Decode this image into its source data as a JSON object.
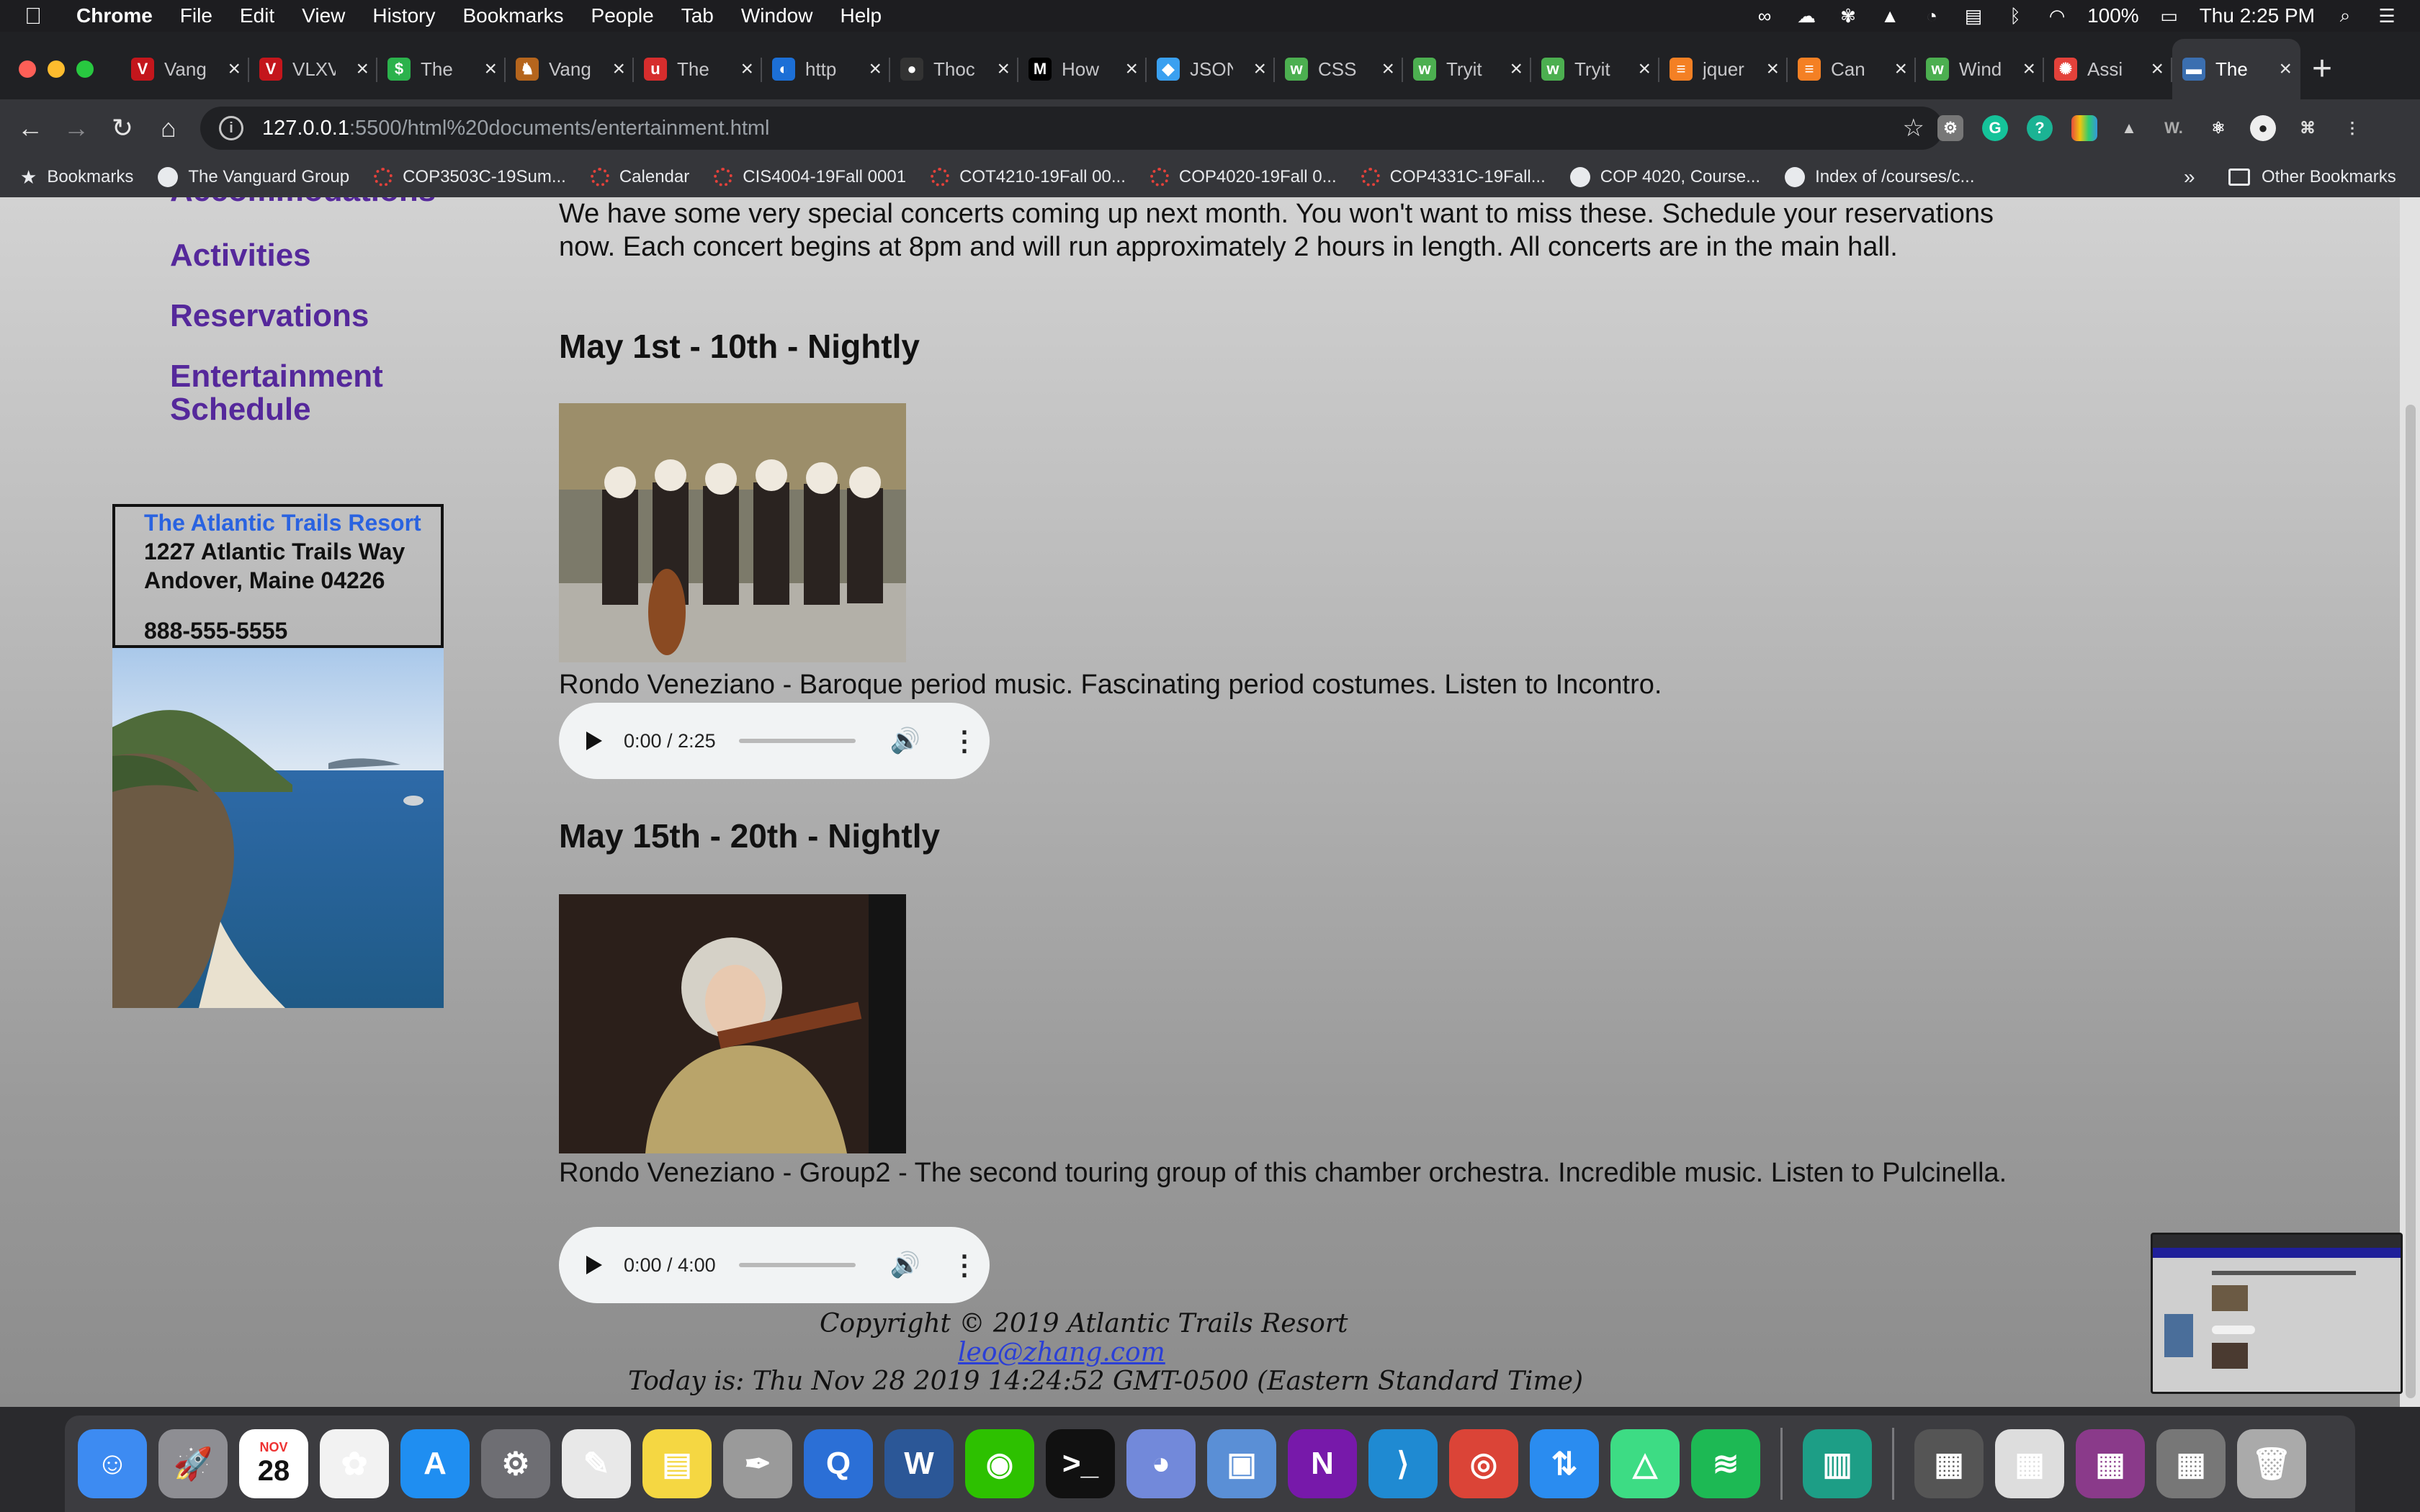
{
  "menubar": {
    "app": "Chrome",
    "items": [
      "File",
      "Edit",
      "View",
      "History",
      "Bookmarks",
      "People",
      "Tab",
      "Window",
      "Help"
    ],
    "battery": "100%",
    "clock": "Thu 2:25 PM"
  },
  "tabs": [
    {
      "title": "Vang",
      "icon": "V",
      "color": "#c4161c"
    },
    {
      "title": "VLXV",
      "icon": "V",
      "color": "#c4161c"
    },
    {
      "title": "The",
      "icon": "$",
      "color": "#2bb24c"
    },
    {
      "title": "Vang",
      "icon": "♞",
      "color": "#b5651d"
    },
    {
      "title": "The",
      "icon": "u",
      "color": "#d62d2d"
    },
    {
      "title": "http",
      "icon": "◐",
      "color": "#1c6fd6"
    },
    {
      "title": "Thoc",
      "icon": "●",
      "color": "#333"
    },
    {
      "title": "How",
      "icon": "M",
      "color": "#000"
    },
    {
      "title": "JSON",
      "icon": "◆",
      "color": "#3aa0f0"
    },
    {
      "title": "CSS",
      "icon": "w",
      "color": "#4caf50"
    },
    {
      "title": "Tryit",
      "icon": "w",
      "color": "#4caf50"
    },
    {
      "title": "Tryit",
      "icon": "w",
      "color": "#4caf50"
    },
    {
      "title": "jquer",
      "icon": "≡",
      "color": "#f48024"
    },
    {
      "title": "Can",
      "icon": "≡",
      "color": "#f48024"
    },
    {
      "title": "Wind",
      "icon": "w",
      "color": "#4caf50"
    },
    {
      "title": "Assi",
      "icon": "✺",
      "color": "#e3413a"
    },
    {
      "title": "The",
      "icon": "▬",
      "color": "#3b6fb0",
      "active": true
    }
  ],
  "address": {
    "host": "127.0.0.1",
    "path": ":5500/html%20documents/entertainment.html"
  },
  "bookmarks": {
    "label": "Bookmarks",
    "items": [
      {
        "label": "The Vanguard Group",
        "icon": "globe"
      },
      {
        "label": "COP3503C-19Sum...",
        "icon": "fsu"
      },
      {
        "label": "Calendar",
        "icon": "fsu"
      },
      {
        "label": "CIS4004-19Fall 0001",
        "icon": "fsu"
      },
      {
        "label": "COT4210-19Fall 00...",
        "icon": "fsu"
      },
      {
        "label": "COP4020-19Fall 0...",
        "icon": "fsu"
      },
      {
        "label": "COP4331C-19Fall...",
        "icon": "fsu"
      },
      {
        "label": "COP 4020, Course...",
        "icon": "globe"
      },
      {
        "label": "Index of /courses/c...",
        "icon": "globe"
      }
    ],
    "more": "»",
    "other": "Other Bookmarks"
  },
  "page": {
    "nav": {
      "accommodations": "Accommodations",
      "activities": "Activities",
      "reservations": "Reservations",
      "entertainment_line1": "Entertainment",
      "entertainment_line2": "Schedule"
    },
    "contact": {
      "name": "The Atlantic Trails Resort",
      "street": "1227 Atlantic Trails Way",
      "city": "Andover, Maine 04226",
      "phone": "888-555-5555"
    },
    "intro": "We have some very special concerts coming up next month. You won't want to miss these. Schedule your reservations now. Each concert begins at 8pm and will run approximately 2 hours in length. All concerts are in the main hall.",
    "shows": [
      {
        "heading": "May 1st - 10th - Nightly",
        "description": "Rondo Veneziano - Baroque period music. Fascinating period costumes. Listen to Incontro.",
        "audio_time": "0:00 / 2:25"
      },
      {
        "heading": "May 15th - 20th - Nightly",
        "description": "Rondo Veneziano - Group2 - The second touring group of this chamber orchestra. Incredible music. Listen to Pulcinella.",
        "audio_time": "0:00 / 4:00"
      }
    ],
    "footer": {
      "copyright": "Copyright © 2019 Atlantic Trails Resort",
      "email": "leo@zhang.com",
      "today": "Today is: Thu Nov 28 2019 14:24:52 GMT-0500 (Eastern Standard Time)"
    }
  },
  "dock": {
    "calendar_month": "NOV",
    "calendar_day": "28",
    "apps": [
      {
        "name": "finder",
        "glyph": "☺",
        "color": "#3d8bf2"
      },
      {
        "name": "launchpad",
        "glyph": "🚀",
        "color": "#8e8e93"
      },
      {
        "name": "calendar",
        "glyph": "",
        "color": "#ffffff"
      },
      {
        "name": "photos",
        "glyph": "✿",
        "color": "#f2f2f2"
      },
      {
        "name": "app-store",
        "glyph": "A",
        "color": "#1f8ef1"
      },
      {
        "name": "system-preferences",
        "glyph": "⚙",
        "color": "#6e6e73"
      },
      {
        "name": "textedit",
        "glyph": "✎",
        "color": "#e8e8e8"
      },
      {
        "name": "stickies",
        "glyph": "▤",
        "color": "#f5d742"
      },
      {
        "name": "script-editor",
        "glyph": "✒",
        "color": "#9a9a9a"
      },
      {
        "name": "quicktime",
        "glyph": "Q",
        "color": "#2b6fd6"
      },
      {
        "name": "word",
        "glyph": "W",
        "color": "#2b5797"
      },
      {
        "name": "wechat",
        "glyph": "◉",
        "color": "#2dc100"
      },
      {
        "name": "terminal",
        "glyph": ">_",
        "color": "#111111"
      },
      {
        "name": "discord",
        "glyph": "◕",
        "color": "#7289da"
      },
      {
        "name": "preview",
        "glyph": "▣",
        "color": "#5a8fd6"
      },
      {
        "name": "onenote",
        "glyph": "N",
        "color": "#7719aa"
      },
      {
        "name": "vscode",
        "glyph": "⟩",
        "color": "#1f8ad2"
      },
      {
        "name": "chrome",
        "glyph": "◎",
        "color": "#db4437"
      },
      {
        "name": "transmit",
        "glyph": "⇅",
        "color": "#2a8cf0"
      },
      {
        "name": "android-studio",
        "glyph": "△",
        "color": "#3ddc84"
      },
      {
        "name": "spotify",
        "glyph": "≋",
        "color": "#1db954"
      },
      {
        "name": "sep",
        "glyph": "",
        "color": ""
      },
      {
        "name": "sequel",
        "glyph": "▥",
        "color": "#1d9e86"
      },
      {
        "name": "sep",
        "glyph": "",
        "color": ""
      },
      {
        "name": "minimized-1",
        "glyph": "▦",
        "color": "#555"
      },
      {
        "name": "minimized-2",
        "glyph": "▦",
        "color": "#ddd"
      },
      {
        "name": "minimized-3",
        "glyph": "▦",
        "color": "#8a3a8a"
      },
      {
        "name": "minimized-4",
        "glyph": "▦",
        "color": "#777"
      },
      {
        "name": "trash",
        "glyph": "🗑",
        "color": "#aaaaaa"
      }
    ]
  }
}
